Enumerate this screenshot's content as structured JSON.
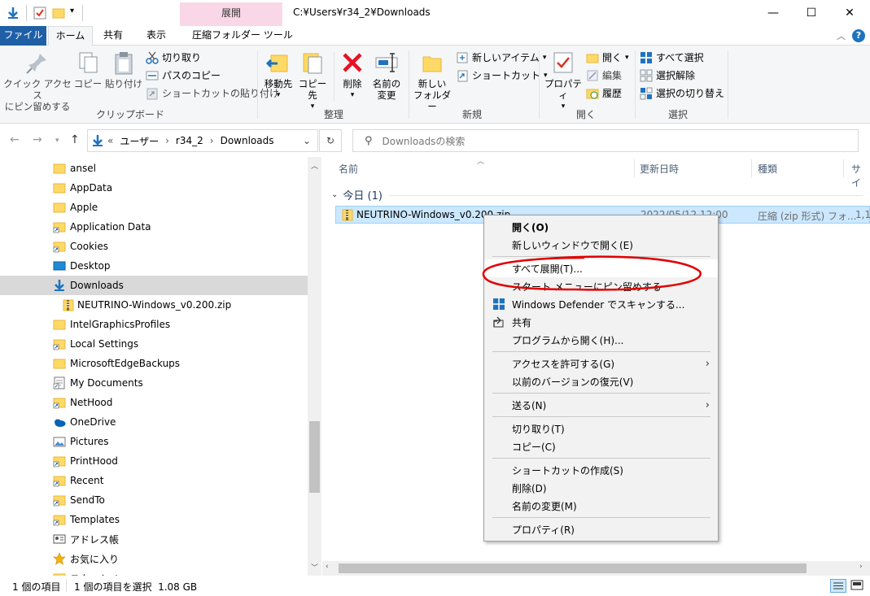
{
  "window": {
    "title": "C:¥Users¥r34_2¥Downloads",
    "context_tab_group": "展開",
    "buttons": {
      "minimize": "—",
      "maximize": "☐",
      "close": "✕"
    }
  },
  "ribbon_tabs": {
    "file": "ファイル",
    "home": "ホーム",
    "share": "共有",
    "view": "表示",
    "compressed": "圧縮フォルダー ツール"
  },
  "ribbon": {
    "clipboard": {
      "label": "クリップボード",
      "pin_quick_access": [
        "クイック アクセス",
        "にピン留めする"
      ],
      "copy": "コピー",
      "paste": "貼り付け",
      "cut": "切り取り",
      "copy_path": "パスのコピー",
      "paste_shortcut": "ショートカットの貼り付け"
    },
    "organize": {
      "label": "整理",
      "move_to": "移動先",
      "copy_to": "コピー先",
      "delete": "削除",
      "rename": [
        "名前の",
        "変更"
      ]
    },
    "new": {
      "label": "新規",
      "new_folder": [
        "新しい",
        "フォルダー"
      ],
      "new_item": "新しいアイテム",
      "shortcut": "ショートカット"
    },
    "open": {
      "label": "開く",
      "properties": "プロパティ",
      "open": "開く",
      "edit": "編集",
      "history": "履歴"
    },
    "select": {
      "label": "選択",
      "select_all": "すべて選択",
      "select_none": "選択解除",
      "invert": "選択の切り替え"
    }
  },
  "address": {
    "crumbs": [
      "«",
      "ユーザー",
      "r34_2",
      "Downloads"
    ],
    "search_placeholder": "Downloadsの検索"
  },
  "nav_tree": [
    {
      "label": "ansel",
      "icon": "folder-icon"
    },
    {
      "label": "AppData",
      "icon": "folder-icon"
    },
    {
      "label": "Apple",
      "icon": "folder-icon"
    },
    {
      "label": "Application Data",
      "icon": "folder-shortcut-icon"
    },
    {
      "label": "Cookies",
      "icon": "folder-shortcut-icon"
    },
    {
      "label": "Desktop",
      "icon": "desktop-icon"
    },
    {
      "label": "Downloads",
      "icon": "downloads-icon",
      "selected": true
    },
    {
      "label": "NEUTRINO-Windows_v0.200.zip",
      "icon": "zip-icon",
      "indent": true
    },
    {
      "label": "IntelGraphicsProfiles",
      "icon": "folder-icon"
    },
    {
      "label": "Local Settings",
      "icon": "folder-shortcut-icon"
    },
    {
      "label": "MicrosoftEdgeBackups",
      "icon": "folder-icon"
    },
    {
      "label": "My Documents",
      "icon": "documents-shortcut-icon"
    },
    {
      "label": "NetHood",
      "icon": "folder-shortcut-icon"
    },
    {
      "label": "OneDrive",
      "icon": "onedrive-icon"
    },
    {
      "label": "Pictures",
      "icon": "pictures-icon"
    },
    {
      "label": "PrintHood",
      "icon": "folder-shortcut-icon"
    },
    {
      "label": "Recent",
      "icon": "folder-shortcut-icon"
    },
    {
      "label": "SendTo",
      "icon": "folder-shortcut-icon"
    },
    {
      "label": "Templates",
      "icon": "folder-shortcut-icon"
    },
    {
      "label": "アドレス帳",
      "icon": "contacts-icon"
    },
    {
      "label": "お気に入り",
      "icon": "favorites-star-icon"
    },
    {
      "label": "スタートメニ",
      "icon": "folder-shortcut-icon"
    }
  ],
  "file_list": {
    "columns": [
      "名前",
      "更新日時",
      "種類",
      "サイ"
    ],
    "group": "今日 (1)",
    "row": {
      "name": "NEUTRINO-Windows_v0.200.zip",
      "modified": "2022/05/12 12:00",
      "type": "圧縮 (zip 形式) フォ...",
      "size": "1,1"
    }
  },
  "context_menu": [
    {
      "label": "開く(O)",
      "bold": true
    },
    {
      "label": "新しいウィンドウで開く(E)"
    },
    {
      "sep": true
    },
    {
      "label": "すべて展開(T)...",
      "highlighted": true
    },
    {
      "label": "スタート メニューにピン留めする"
    },
    {
      "label": "Windows Defender でスキャンする...",
      "icon": "defender-icon"
    },
    {
      "label": "共有",
      "icon": "share-icon"
    },
    {
      "label": "プログラムから開く(H)..."
    },
    {
      "sep": true
    },
    {
      "label": "アクセスを許可する(G)",
      "submenu": true
    },
    {
      "label": "以前のバージョンの復元(V)"
    },
    {
      "sep": true
    },
    {
      "label": "送る(N)",
      "submenu": true
    },
    {
      "sep": true
    },
    {
      "label": "切り取り(T)"
    },
    {
      "label": "コピー(C)"
    },
    {
      "sep": true
    },
    {
      "label": "ショートカットの作成(S)"
    },
    {
      "label": "削除(D)"
    },
    {
      "label": "名前の変更(M)"
    },
    {
      "sep": true
    },
    {
      "label": "プロパティ(R)"
    }
  ],
  "status": {
    "count": "1 個の項目",
    "selected": "1 個の項目を選択  1.08 GB"
  },
  "colors": {
    "file_tab": "#1f5fa6",
    "context_tab": "#f9d7e6",
    "selection": "#cce8ff",
    "annotation": "#e00000"
  }
}
